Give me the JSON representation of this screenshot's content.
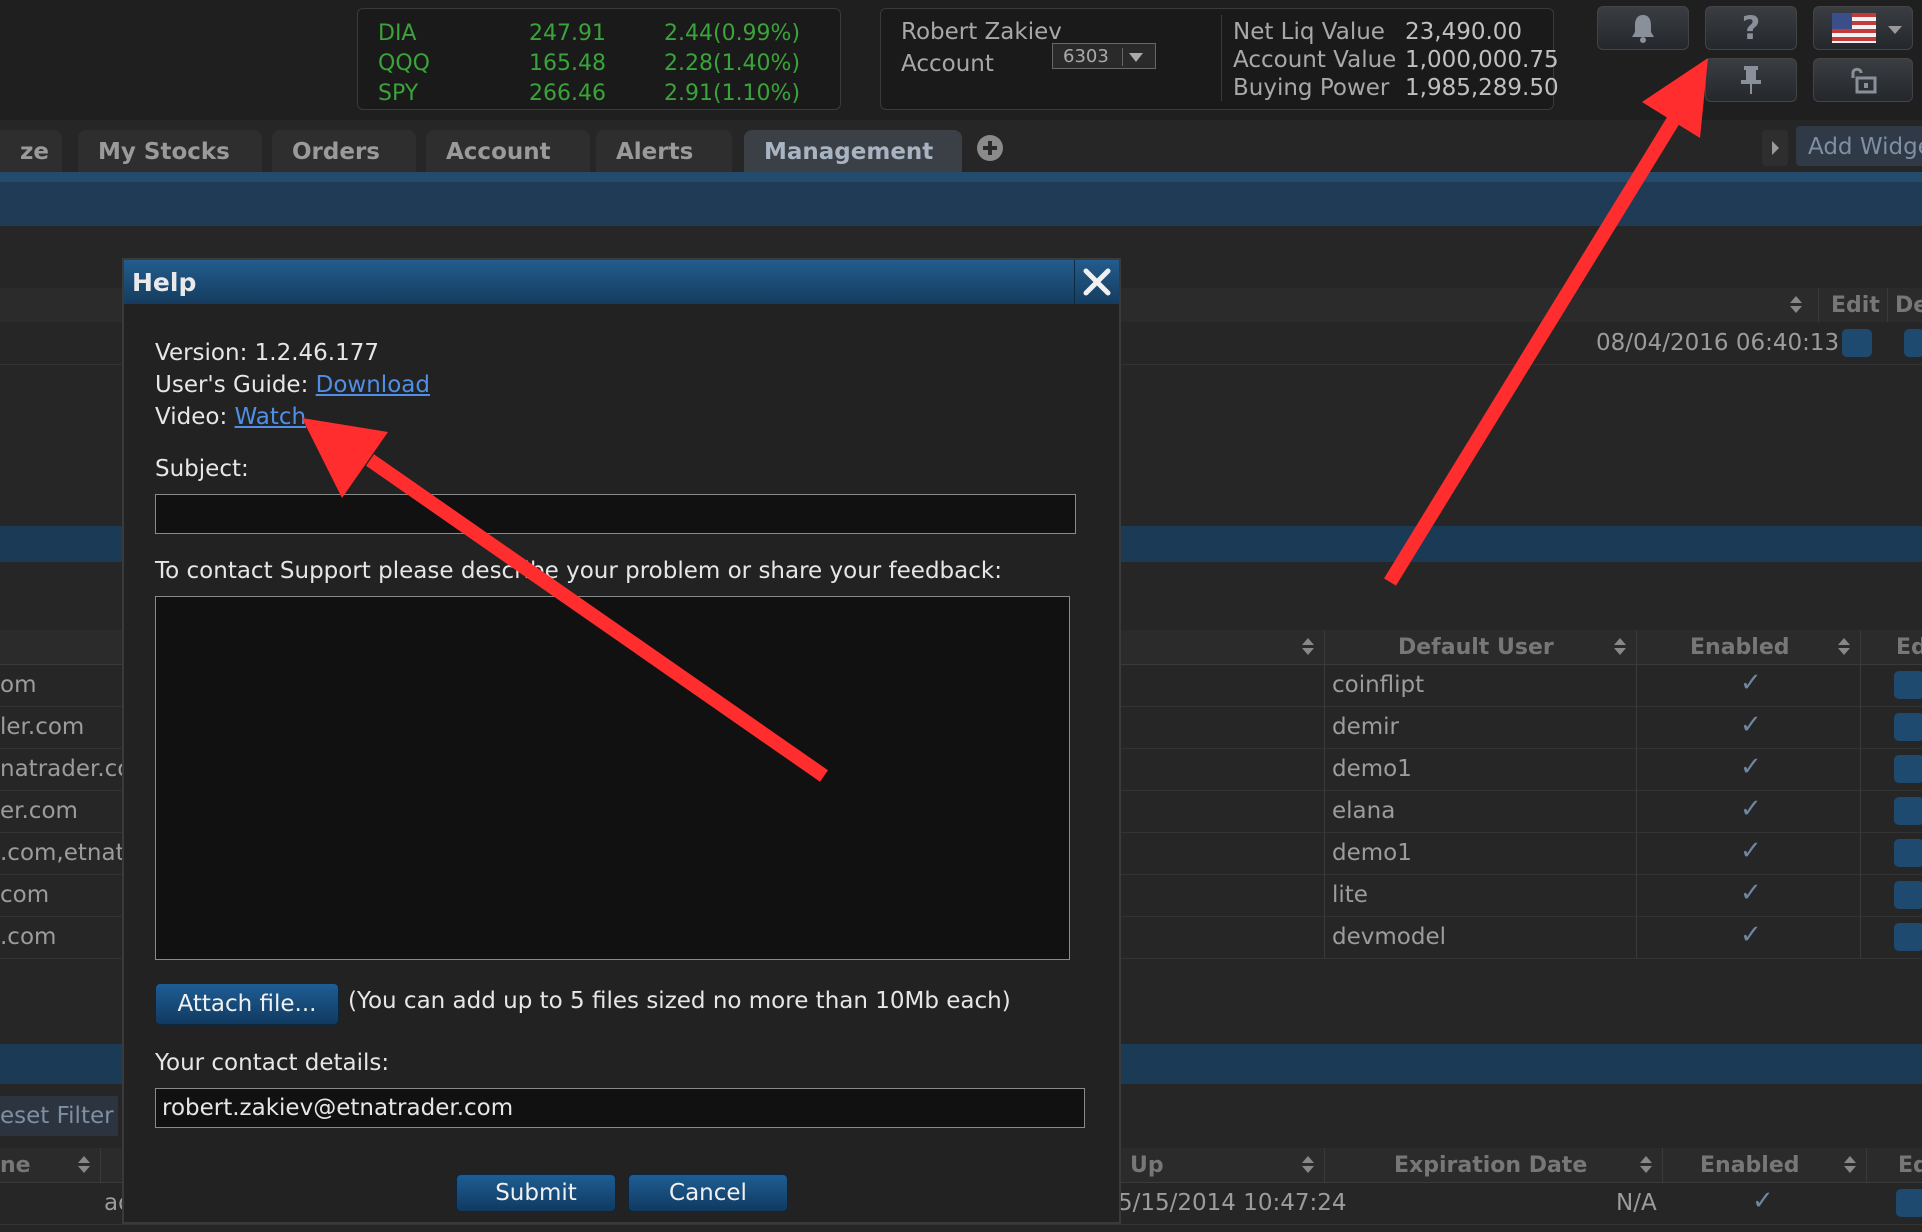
{
  "ticker": {
    "rows": [
      {
        "symbol": "DIA",
        "price": "247.91",
        "change": "2.44(0.99%)"
      },
      {
        "symbol": "QQQ",
        "price": "165.48",
        "change": "2.28(1.40%)"
      },
      {
        "symbol": "SPY",
        "price": "266.46",
        "change": "2.91(1.10%)"
      }
    ]
  },
  "account": {
    "user_name": "Robert Zakiev",
    "account_label": "Account",
    "account_number": "6303",
    "net_liq_label": "Net Liq Value",
    "net_liq_value": "23,490.00",
    "account_value_label": "Account Value",
    "account_value_value": "1,000,000.75",
    "buying_power_label": "Buying Power",
    "buying_power_value": "1,985,289.50"
  },
  "toolbar": {
    "help_glyph": "?",
    "add_widget_label": "Add Widge"
  },
  "tabs": [
    {
      "label": "ze"
    },
    {
      "label": "My Stocks"
    },
    {
      "label": "Orders"
    },
    {
      "label": "Account"
    },
    {
      "label": "Alerts"
    },
    {
      "label": "Management"
    }
  ],
  "grid_top": {
    "edit_header": "Edit",
    "de_header": "De",
    "timestamp": "08/04/2016 06:40:13"
  },
  "grid_mid": {
    "default_user_header": "Default User",
    "enabled_header": "Enabled",
    "ed_header": "Ed",
    "rows": [
      {
        "left": "om",
        "user": "coinflipt"
      },
      {
        "left": "ler.com",
        "user": "demir"
      },
      {
        "left": "natrader.com",
        "user": "demo1"
      },
      {
        "left": "er.com",
        "user": "elana"
      },
      {
        "left": ".com,etnatr",
        "user": "demo1"
      },
      {
        "left": "com",
        "user": "lite"
      },
      {
        "left": ".com",
        "user": "devmodel"
      }
    ]
  },
  "grid_bottom": {
    "reset_filter": "eset Filter",
    "name_header": "ne",
    "up_header": "Up",
    "expiration_header": "Expiration Date",
    "enabled_header": "Enabled",
    "ed_header": "Ed",
    "row_left": "ad",
    "row_date": "5/15/2014 10:47:24",
    "row_expiration": "N/A"
  },
  "help_dialog": {
    "title": "Help",
    "version_text": "Version: 1.2.46.177",
    "guide_label": "User's Guide: ",
    "guide_link": "Download",
    "video_label": "Video: ",
    "video_link": "Watch",
    "subject_label": "Subject:",
    "subject_value": "",
    "description_label": "To contact Support please describe your problem or share your feedback:",
    "description_value": "",
    "attach_button": "Attach file...",
    "attach_note": "(You can add up to 5 files sized no more than 10Mb each)",
    "contact_label": "Your contact details:",
    "contact_value": "robert.zakiev@etnatrader.com",
    "submit_button": "Submit",
    "cancel_button": "Cancel"
  },
  "colors": {
    "ticker_green": "#3aa33a",
    "dialog_title_blue": "#235c8e",
    "link_blue": "#4f8fe6",
    "annotation_red": "#ff2d2d"
  }
}
